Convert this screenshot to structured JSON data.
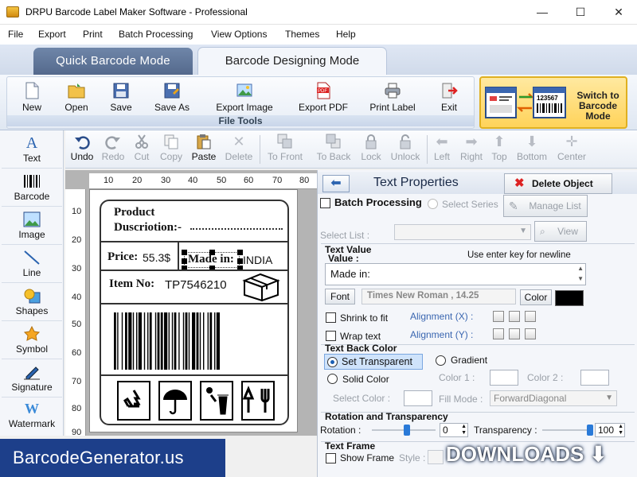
{
  "window": {
    "title": "DRPU Barcode Label Maker Software - Professional",
    "min": "—",
    "max": "☐",
    "close": "✕"
  },
  "menu": [
    "File",
    "Export",
    "Print",
    "Batch Processing",
    "View Options",
    "Themes",
    "Help"
  ],
  "mode_tabs": {
    "quick": "Quick Barcode Mode",
    "designing": "Barcode Designing Mode"
  },
  "file_tools": {
    "caption": "File Tools",
    "buttons": [
      "New",
      "Open",
      "Save",
      "Save As",
      "Export Image",
      "Export PDF",
      "Print Label",
      "Exit"
    ],
    "switch_label": "Switch to Barcode Mode",
    "switch_code": "123567"
  },
  "left_tools": [
    "Text",
    "Barcode",
    "Image",
    "Line",
    "Shapes",
    "Symbol",
    "Signature",
    "Watermark"
  ],
  "edit_tools": [
    "Undo",
    "Redo",
    "Cut",
    "Copy",
    "Paste",
    "Delete",
    "To Front",
    "To Back",
    "Lock",
    "Unlock",
    "Left",
    "Right",
    "Top",
    "Bottom",
    "Center"
  ],
  "ruler": {
    "h": [
      "10",
      "20",
      "30",
      "40",
      "50",
      "60",
      "70",
      "80"
    ],
    "v": [
      "10",
      "20",
      "30",
      "40",
      "50",
      "60",
      "70",
      "80",
      "90"
    ]
  },
  "label": {
    "product": "Product",
    "description": "Duscriotion:-",
    "price_label": "Price:",
    "price_value": "55.3$",
    "made_label": "Made in:",
    "made_value": "INDIA",
    "item_label": "Item No:",
    "item_value": "TP7546210"
  },
  "props": {
    "title": "Text Properties",
    "delete": "Delete Object",
    "batch": "Batch Processing",
    "select_series": "Select Series",
    "manage_list": "Manage List",
    "select_list": "Select List :",
    "view": "View",
    "text_value": "Text Value",
    "value_label": "Value :",
    "hint": "Use enter key for newline",
    "value": "Made in:",
    "font_btn": "Font",
    "font_name": "Times New Roman , 14.25",
    "color_btn": "Color",
    "text_color": "#000000",
    "shrink": "Shrink to fit",
    "wrap": "Wrap text",
    "align_x": "Alignment (X) :",
    "align_y": "Alignment (Y) :",
    "back_color": "Text Back Color",
    "set_transparent": "Set Transparent",
    "gradient": "Gradient",
    "solid_color": "Solid Color",
    "color1": "Color 1 :",
    "color2": "Color 2 :",
    "select_color": "Select Color :",
    "fill_mode": "Fill Mode :",
    "fill_mode_value": "ForwardDiagonal",
    "rotation_section": "Rotation and Transparency",
    "rotation": "Rotation :",
    "rotation_value": "0",
    "transparency": "Transparency :",
    "transparency_value": "100",
    "text_frame": "Text Frame",
    "show_frame": "Show Frame",
    "style": "Style :"
  },
  "watermarks": {
    "left": "BarcodeGenerator.us",
    "right": "DOWNLOADS ⬇ GURU"
  }
}
